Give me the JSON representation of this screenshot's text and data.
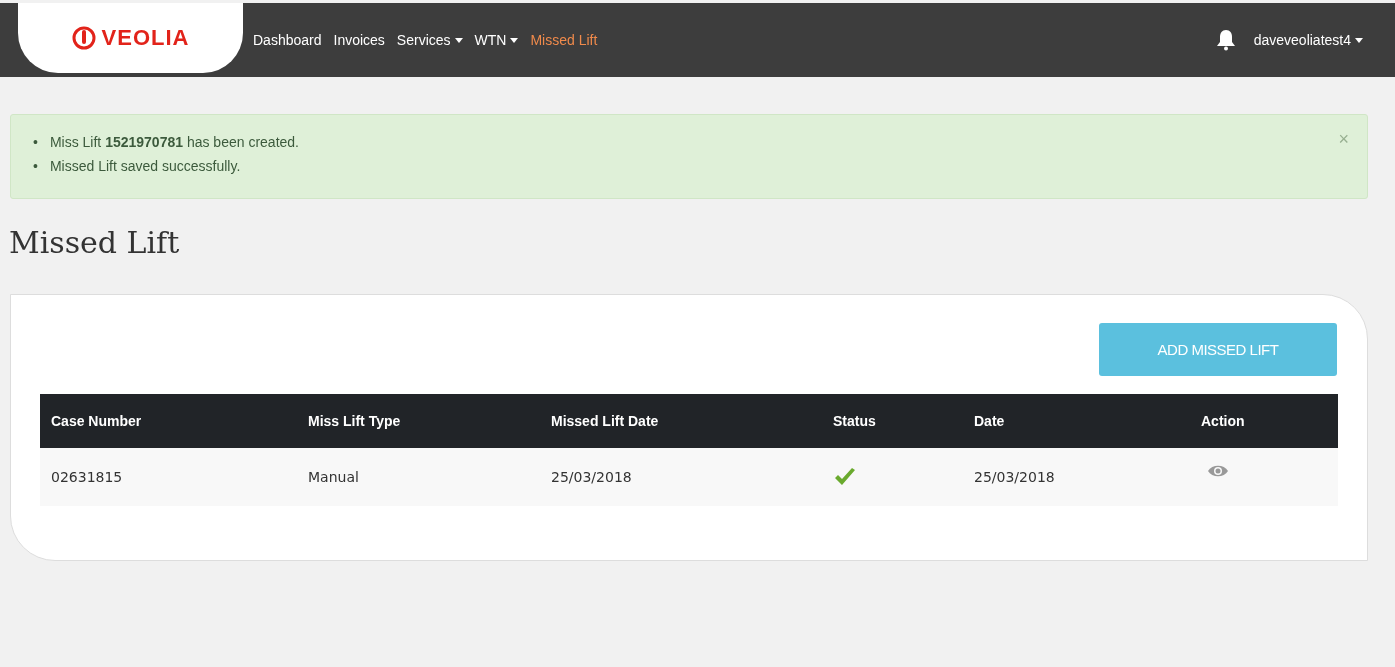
{
  "brand": {
    "name": "VEOLIA"
  },
  "nav": [
    {
      "label": "Dashboard",
      "dropdown": false,
      "selected": false
    },
    {
      "label": "Invoices",
      "dropdown": false,
      "selected": false
    },
    {
      "label": "Services",
      "dropdown": true,
      "selected": false
    },
    {
      "label": "WTN",
      "dropdown": true,
      "selected": false
    },
    {
      "label": "Missed Lift",
      "dropdown": false,
      "selected": true
    }
  ],
  "user": {
    "name": "daveveoliatest4",
    "dropdown": true
  },
  "alert": {
    "messages": [
      {
        "bullet": "•",
        "text": "Miss Lift **1521970781** has been created."
      },
      {
        "bullet": "•",
        "text": "Missed Lift saved successfully."
      }
    ],
    "close": "×"
  },
  "page_title": "Missed Lift",
  "add_button": "ADD MISSED LIFT",
  "table": {
    "columns": [
      "Case Number",
      "Miss Lift Type",
      "Missed Lift Date",
      "Status",
      "Date",
      "Action"
    ],
    "rows": [
      {
        "case_number": "02631815",
        "type": "Manual",
        "missed_lift_date": "25/03/2018",
        "status_ok": true,
        "date": "25/03/2018"
      }
    ]
  }
}
